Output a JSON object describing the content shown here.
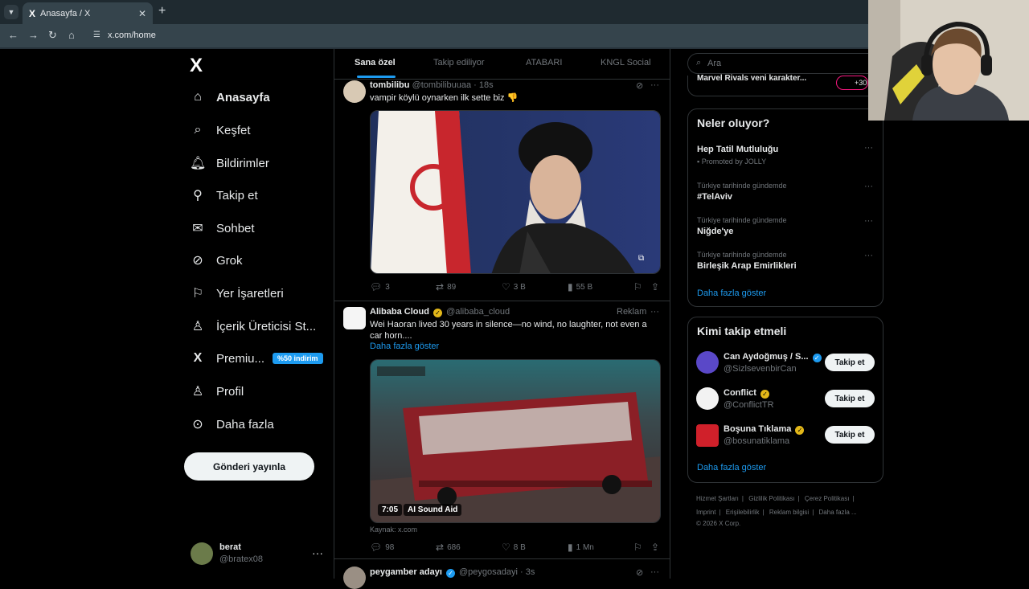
{
  "browser": {
    "tab_title": "Anasayfa / X",
    "tab_favicon": "X",
    "url": "x.com/home"
  },
  "sidebar": {
    "logo": "X",
    "items": [
      {
        "label": "Anasayfa",
        "icon": "home-icon",
        "glyph": "⌂",
        "active": true
      },
      {
        "label": "Keşfet",
        "icon": "search-icon",
        "glyph": "⌕"
      },
      {
        "label": "Bildirimler",
        "icon": "bell-icon",
        "glyph": "♫"
      },
      {
        "label": "Takip et",
        "icon": "person-add-icon",
        "glyph": "⚇"
      },
      {
        "label": "Sohbet",
        "icon": "envelope-icon",
        "glyph": "✉"
      },
      {
        "label": "Grok",
        "icon": "grok-icon",
        "glyph": "⊘"
      },
      {
        "label": "Yer İşaretleri",
        "icon": "bookmark-icon",
        "glyph": "❏"
      },
      {
        "label": "İçerik Üreticisi St...",
        "icon": "creator-studio-icon",
        "glyph": "♙"
      },
      {
        "label": "Premiu...",
        "icon": "x-premium-icon",
        "glyph": "X",
        "badge": "%50 indirim"
      },
      {
        "label": "Profil",
        "icon": "profile-icon",
        "glyph": "♙"
      },
      {
        "label": "Daha fazla",
        "icon": "more-circle-icon",
        "glyph": "⊙"
      }
    ],
    "post_button": "Gönderi yayınla",
    "user": {
      "name": "berat",
      "handle": "@bratex08"
    }
  },
  "feed": {
    "tabs": [
      "Sana özel",
      "Takip ediliyor",
      "ATABARI",
      "KNGL Social"
    ],
    "tweets": [
      {
        "name": "tombilibu",
        "handle": "@tombilibuuaa",
        "time": "· 18s",
        "text": "vampir köylü oynarken ilk sette biz 👎",
        "replies": "3",
        "retweets": "89",
        "likes": "3 B",
        "views": "55 B"
      },
      {
        "name": "Alibaba Cloud",
        "handle": "@alibaba_cloud",
        "right_label": "Reklam",
        "text": "Wei Haoran lived 30 years in silence—no wind, no laughter, not even a car horn....",
        "show_more": "Daha fazla göster",
        "video_time": "7:05",
        "video_badge": "AI Sound Aid",
        "source": "Kaynak: x.com",
        "replies": "98",
        "retweets": "686",
        "likes": "8 B",
        "views": "1 Mn"
      },
      {
        "name": "peygamber adayı",
        "handle": "@peygosadayi",
        "time": "· 3s"
      }
    ]
  },
  "right": {
    "search_placeholder": "Ara",
    "partial_top": "Marvel Rivals yeni karakter...",
    "partial_badge": "+30",
    "trends": {
      "title": "Neler oluyor?",
      "items": [
        {
          "name": "Hep Tatil Mutluluğu",
          "meta": "Promoted by JOLLY",
          "promoted": true
        },
        {
          "meta": "Türkiye tarihinde gündemde",
          "name": "#TelAviv"
        },
        {
          "meta": "Türkiye tarihinde gündemde",
          "name": "Niğde'ye"
        },
        {
          "meta": "Türkiye tarihinde gündemde",
          "name": "Birleşik Arap Emirlikleri"
        }
      ],
      "show_more": "Daha fazla göster"
    },
    "who_to_follow": {
      "title": "Kimi takip etmeli",
      "follow_label": "Takip et",
      "items": [
        {
          "name": "Can Aydoğmuş / S...",
          "handle": "@SizlsevenbirCan",
          "badge": "blue"
        },
        {
          "name": "Conflict",
          "handle": "@ConflictTR",
          "badge": "gold"
        },
        {
          "name": "Boşuna Tıklama",
          "handle": "@bosunatiklama",
          "badge": "gold"
        }
      ],
      "show_more": "Daha fazla göster"
    },
    "footer": {
      "row1": [
        "Hizmet Şartları",
        "|",
        "Gizlilik Politikası",
        "|",
        "Çerez Politikası",
        "|"
      ],
      "row2": [
        "Imprint",
        "|",
        "Erişilebilirlik",
        "|",
        "Reklam bilgisi",
        "|",
        "Daha fazla ..."
      ],
      "copyright": "© 2026 X Corp."
    }
  },
  "colors": {
    "accent": "#1d9bf0",
    "verified_gold": "#e2b719",
    "muted": "#71767b"
  }
}
